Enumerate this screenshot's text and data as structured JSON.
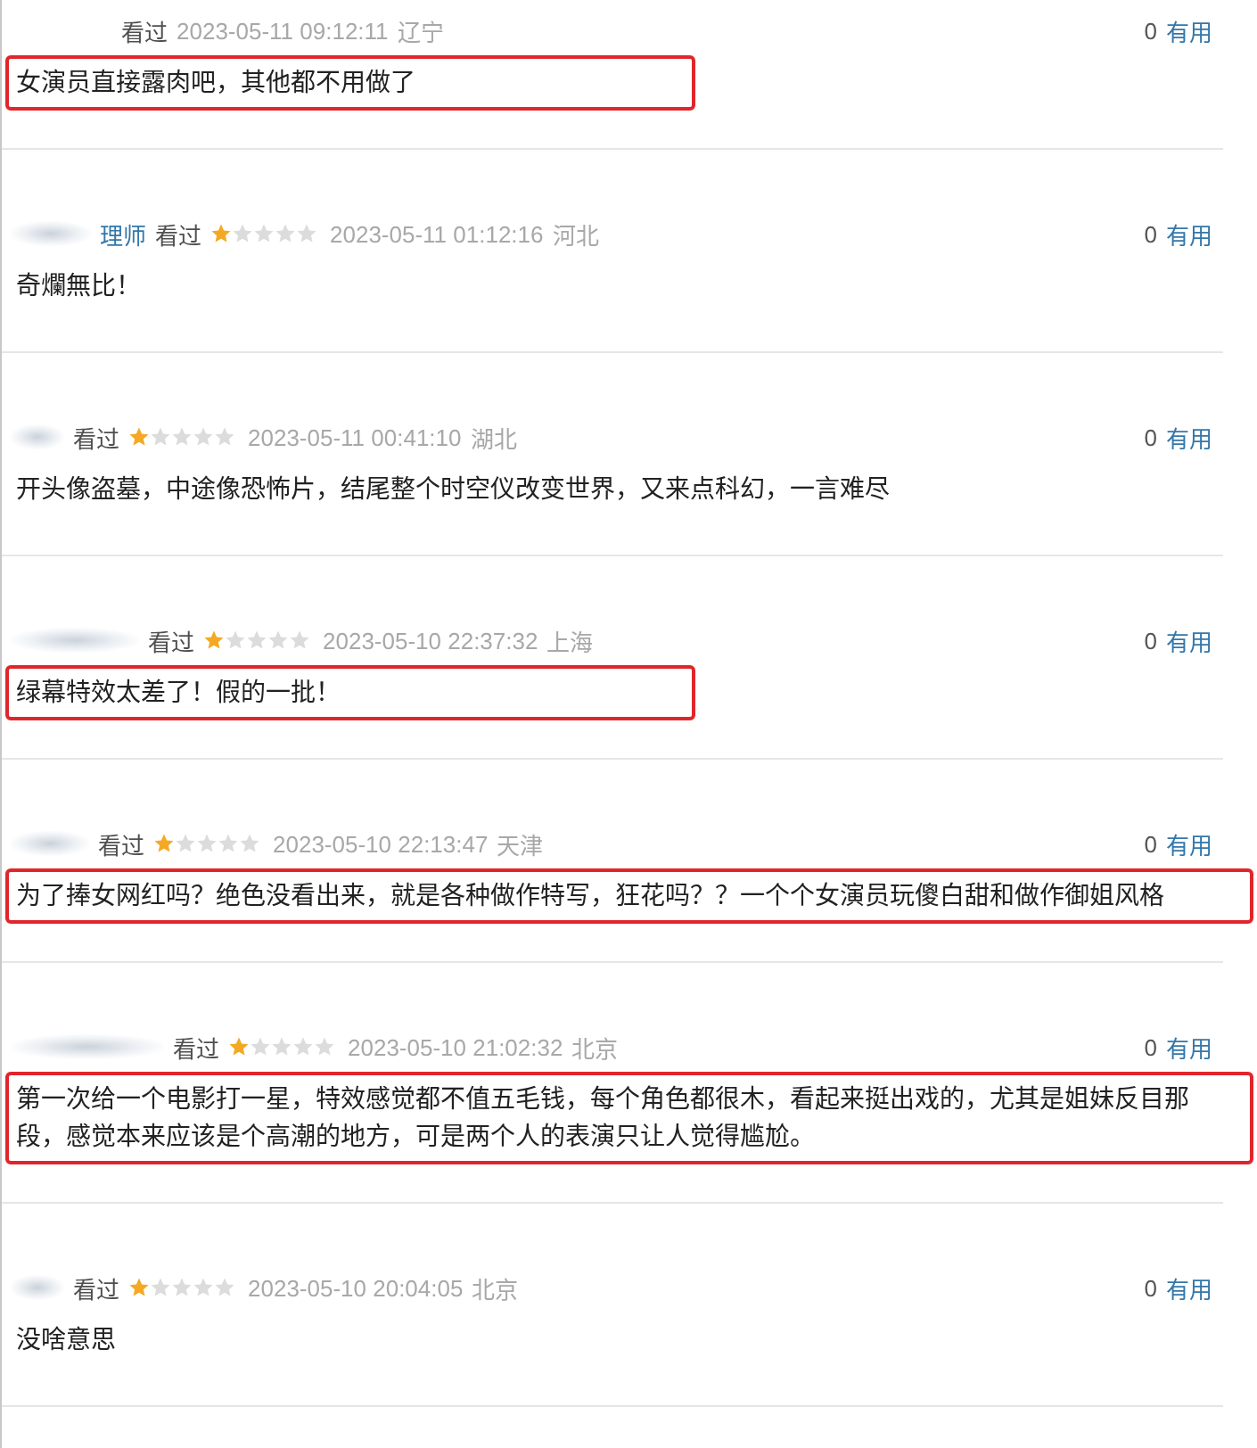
{
  "reviews": [
    {
      "name_blurred": false,
      "status": "看过",
      "date": "2023-05-11 09:12:11",
      "location": "辽宁",
      "votes": "0",
      "useful": "有用",
      "comment": "女演员直接露肉吧，其他都不用做了",
      "highlighted": true
    },
    {
      "name_blurred": true,
      "username": "理师",
      "status": "看过",
      "stars": 1,
      "date": "2023-05-11 01:12:16",
      "location": "河北",
      "votes": "0",
      "useful": "有用",
      "comment": "奇爛無比！",
      "highlighted": false
    },
    {
      "name_blurred": true,
      "status": "看过",
      "stars": 1,
      "date": "2023-05-11 00:41:10",
      "location": "湖北",
      "votes": "0",
      "useful": "有用",
      "comment": "开头像盗墓，中途像恐怖片，结尾整个时空仪改变世界，又来点科幻，一言难尽",
      "highlighted": false
    },
    {
      "name_blurred": true,
      "status": "看过",
      "stars": 1,
      "date": "2023-05-10 22:37:32",
      "location": "上海",
      "votes": "0",
      "useful": "有用",
      "comment": "绿幕特效太差了！假的一批！",
      "highlighted": true
    },
    {
      "name_blurred": true,
      "status": "看过",
      "stars": 1,
      "date": "2023-05-10 22:13:47",
      "location": "天津",
      "votes": "0",
      "useful": "有用",
      "comment": "为了捧女网红吗？绝色没看出来，就是各种做作特写，狂花吗？？一个个女演员玩傻白甜和做作御姐风格",
      "highlighted": true
    },
    {
      "name_blurred": true,
      "status": "看过",
      "stars": 1,
      "date": "2023-05-10 21:02:32",
      "location": "北京",
      "votes": "0",
      "useful": "有用",
      "comment": "第一次给一个电影打一星，特效感觉都不值五毛钱，每个角色都很木，看起来挺出戏的，尤其是姐妹反目那段，感觉本来应该是个高潮的地方，可是两个人的表演只让人觉得尴尬。",
      "highlighted": true
    },
    {
      "name_blurred": true,
      "status": "看过",
      "stars": 1,
      "date": "2023-05-10 20:04:05",
      "location": "北京",
      "votes": "0",
      "useful": "有用",
      "comment": "没啥意思",
      "highlighted": false
    }
  ]
}
